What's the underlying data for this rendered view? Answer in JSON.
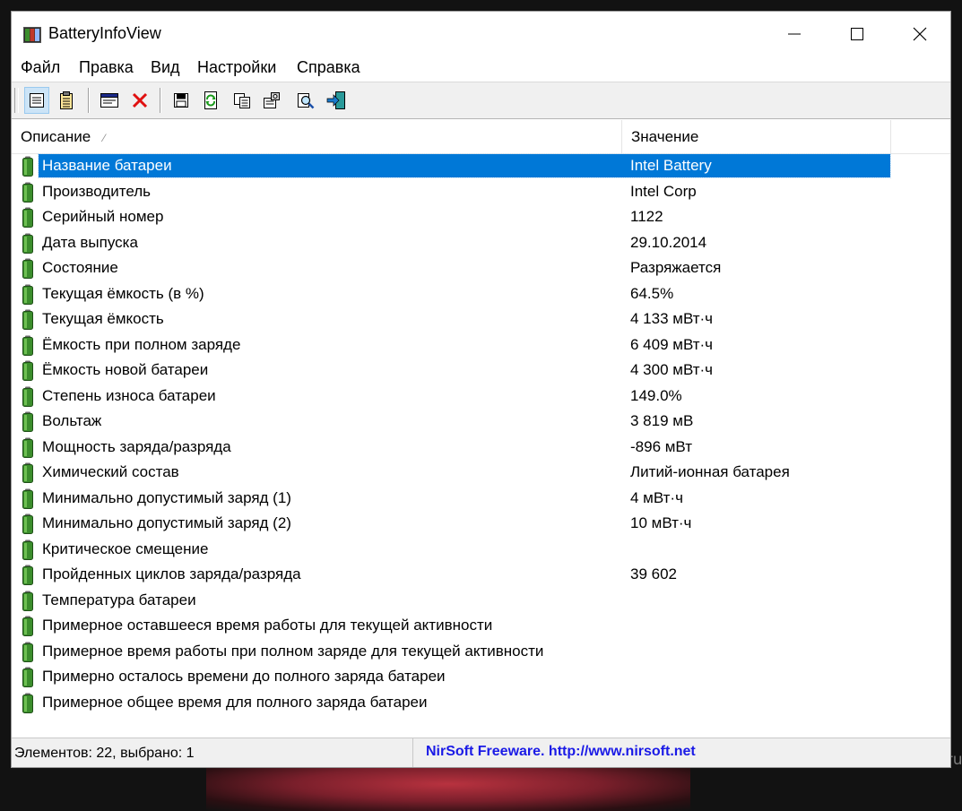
{
  "window": {
    "title": "BatteryInfoView"
  },
  "menu": [
    "Файл",
    "Правка",
    "Вид",
    "Настройки",
    "Справка"
  ],
  "toolbar": {
    "buttons": [
      {
        "name": "battery-info-mode-icon"
      },
      {
        "name": "battery-log-mode-icon"
      },
      {
        "name": "properties-window-icon"
      },
      {
        "name": "delete-icon"
      },
      {
        "name": "save-icon"
      },
      {
        "name": "refresh-icon"
      },
      {
        "name": "copy-icon"
      },
      {
        "name": "html-report-icon"
      },
      {
        "name": "find-icon"
      },
      {
        "name": "exit-icon"
      }
    ]
  },
  "list": {
    "columns": {
      "description": "Описание",
      "value": "Значение"
    },
    "selected_index": 0,
    "rows": [
      {
        "description": "Название батареи",
        "value": "Intel Battery"
      },
      {
        "description": "Производитель",
        "value": "Intel Corp"
      },
      {
        "description": "Серийный номер",
        "value": "1122"
      },
      {
        "description": "Дата выпуска",
        "value": "29.10.2014"
      },
      {
        "description": "Состояние",
        "value": "Разряжается"
      },
      {
        "description": "Текущая ёмкость (в %)",
        "value": "64.5%"
      },
      {
        "description": "Текущая ёмкость",
        "value": "4 133 мВт·ч"
      },
      {
        "description": "Ёмкость при полном заряде",
        "value": "6 409 мВт·ч"
      },
      {
        "description": "Ёмкость новой батареи",
        "value": "4 300 мВт·ч"
      },
      {
        "description": "Степень износа батареи",
        "value": "149.0%"
      },
      {
        "description": "Вольтаж",
        "value": "3 819 мВ"
      },
      {
        "description": "Мощность заряда/разряда",
        "value": "-896 мВт"
      },
      {
        "description": "Химический состав",
        "value": "Литий-ионная батарея"
      },
      {
        "description": "Минимально допустимый заряд (1)",
        "value": "4 мВт·ч"
      },
      {
        "description": "Минимально допустимый заряд (2)",
        "value": "10 мВт·ч"
      },
      {
        "description": "Критическое смещение",
        "value": ""
      },
      {
        "description": "Пройденных циклов заряда/разряда",
        "value": "39 602"
      },
      {
        "description": "Температура батареи",
        "value": ""
      },
      {
        "description": "Примерное оставшееся время работы для текущей активности",
        "value": ""
      },
      {
        "description": "Примерное время работы при полном заряде для текущей активности",
        "value": ""
      },
      {
        "description": "Примерно осталось времени до полного заряда батареи",
        "value": ""
      },
      {
        "description": "Примерное общее время для полного заряда батареи",
        "value": ""
      }
    ]
  },
  "status": {
    "items_text": "Элементов: 22, выбрано: 1",
    "credit": "NirSoft Freeware.  http://www.nirsoft.net"
  },
  "watermark": "www.wincore.ru",
  "colors": {
    "selection": "#0078d7",
    "battery": "#3b8d2c",
    "credit": "#1a1ae6"
  }
}
